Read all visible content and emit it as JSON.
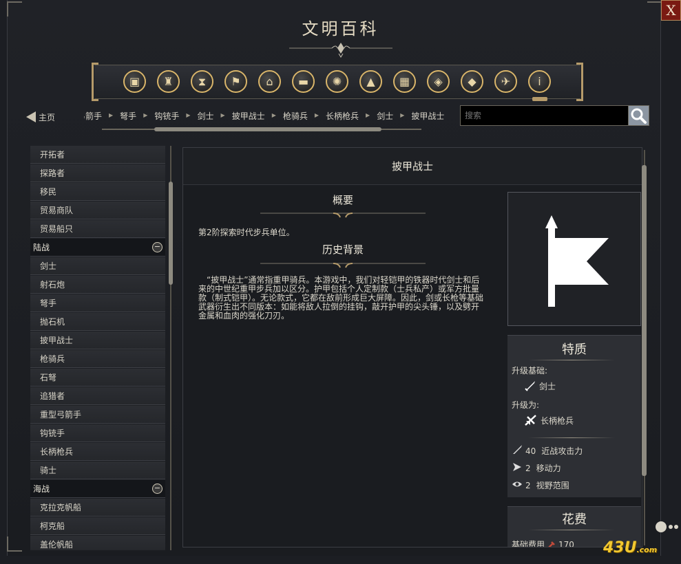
{
  "window": {
    "title": "文明百科",
    "close_label": "X"
  },
  "categories": [
    {
      "icon": "resources-icon"
    },
    {
      "icon": "goods-icon"
    },
    {
      "icon": "hourglass-icon"
    },
    {
      "icon": "flag-icon"
    },
    {
      "icon": "building-icon"
    },
    {
      "icon": "book-icon"
    },
    {
      "icon": "atom-icon"
    },
    {
      "icon": "mountain-icon"
    },
    {
      "icon": "district-icon"
    },
    {
      "icon": "compass-icon"
    },
    {
      "icon": "diamond-icon"
    },
    {
      "icon": "dove-icon"
    },
    {
      "icon": "info-icon"
    }
  ],
  "nav": {
    "home_label": "主页",
    "breadcrumb": [
      "弓箭手",
      "弩手",
      "钩铳手",
      "剑士",
      "披甲战士",
      "枪骑兵",
      "长柄枪兵",
      "剑士",
      "披甲战士"
    ],
    "search_placeholder": "搜索"
  },
  "sidebar": {
    "groups": [
      {
        "label": "",
        "items": [
          "开拓者",
          "探路者",
          "移民",
          "贸易商队",
          "贸易船只"
        ]
      },
      {
        "label": "陆战",
        "items": [
          "剑士",
          "射石炮",
          "弩手",
          "抛石机",
          "披甲战士",
          "枪骑兵",
          "石弩",
          "追猎者",
          "重型弓箭手",
          "钩铳手",
          "长柄枪兵",
          "骑士"
        ]
      },
      {
        "label": "海战",
        "items": [
          "克拉克帆船",
          "柯克船",
          "盖伦帆船"
        ]
      }
    ]
  },
  "article": {
    "title": "披甲战士",
    "summary_title": "概要",
    "summary_text": "第2阶探索时代步兵单位。",
    "history_title": "历史背景",
    "history_text": "“披甲战士”通常指重甲骑兵。本游戏中，我们对轻铠甲的铁器时代剑士和后来的中世纪重甲步兵加以区分。护甲包括个人定制款（士兵私产）或军方批量款（制式铠甲）。无论款式，它都在敌前形成巨大屏障。因此，剑或长枪等基础武器衍生出不同版本：如能将敌人拉倒的挂钩，敲开护甲的尖头锤，以及劈开金属和血肉的强化刀刃。"
  },
  "traits": {
    "title": "特质",
    "upgrade_from_label": "升级基础:",
    "upgrade_from": "剑士",
    "upgrade_to_label": "升级为:",
    "upgrade_to": "长柄枪兵",
    "stats": [
      {
        "icon": "sword-icon",
        "value": "40",
        "label": "近战攻击力"
      },
      {
        "icon": "movement-icon",
        "value": "2",
        "label": "移动力"
      },
      {
        "icon": "eye-icon",
        "value": "2",
        "label": "视野范围"
      }
    ]
  },
  "cost": {
    "title": "花费",
    "base_label": "基础费用",
    "value": "170"
  },
  "watermark": {
    "text": "43U",
    "suffix": ".com"
  }
}
